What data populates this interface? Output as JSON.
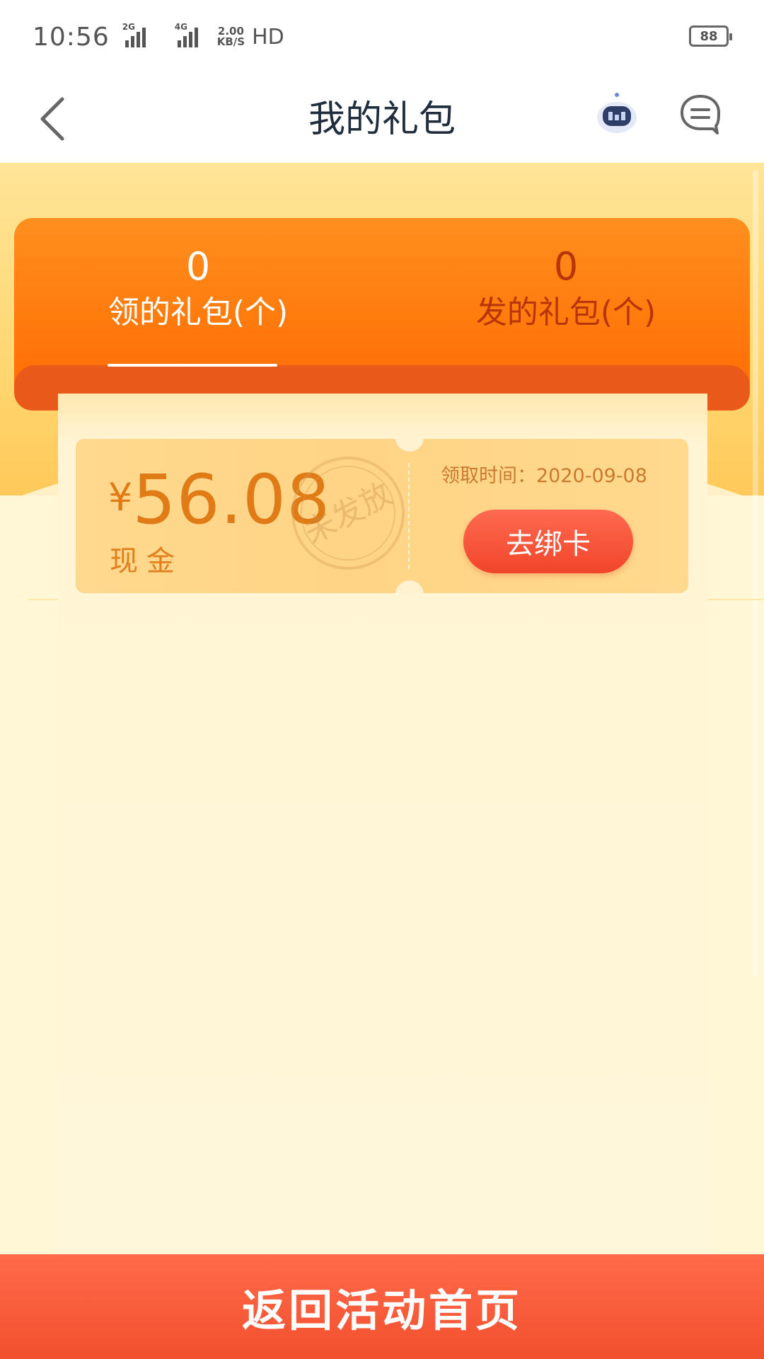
{
  "status_bar": {
    "time": "10:56",
    "signal_1_label": "2G",
    "signal_2_label": "4G",
    "net_speed_value": "2.00",
    "net_speed_unit": "KB/S",
    "hd_label": "HD",
    "battery_level": "88"
  },
  "nav": {
    "title": "我的礼包",
    "back_icon": "chevron-left-icon",
    "robot_icon": "robot-assistant-icon",
    "message_icon": "message-icon"
  },
  "summary": {
    "tabs": [
      {
        "count": "0",
        "label": "领的礼包(个)",
        "active": true
      },
      {
        "count": "0",
        "label": "发的礼包(个)",
        "active": false
      }
    ]
  },
  "coupon": {
    "currency": "¥",
    "amount": "56.08",
    "type_label": "现金",
    "stamp_text": "未发放",
    "claim_time": "领取时间：2020-09-08",
    "action_label": "去绑卡"
  },
  "footer": {
    "button_label": "返回活动首页"
  },
  "colors": {
    "accent_orange": "#FF7A0C",
    "button_red": "#F2502E",
    "amount_orange": "#E07B16"
  }
}
